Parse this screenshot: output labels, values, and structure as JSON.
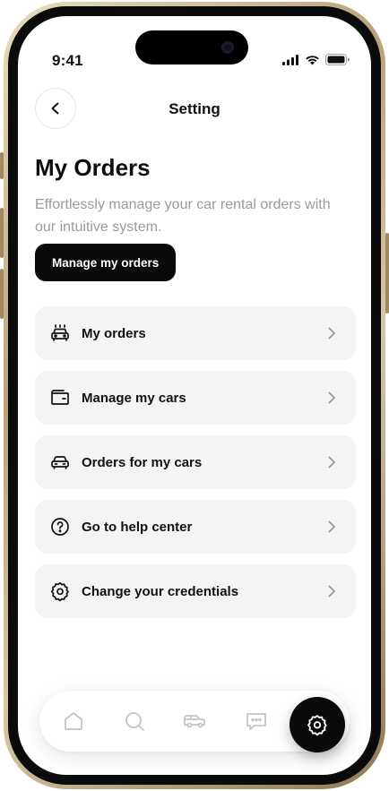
{
  "status_bar": {
    "time": "9:41"
  },
  "header": {
    "title": "Setting"
  },
  "intro": {
    "title": "My Orders",
    "subtitle": "Effortlessly manage your car rental orders with our intuitive system.",
    "cta_label": "Manage my orders"
  },
  "menu": {
    "items": [
      {
        "label": "My orders",
        "icon": "car-front-icon"
      },
      {
        "label": "Manage my cars",
        "icon": "wallet-icon"
      },
      {
        "label": "Orders for my cars",
        "icon": "car-icon"
      },
      {
        "label": "Go to help center",
        "icon": "help-circle-icon"
      },
      {
        "label": "Change your credentials",
        "icon": "gear-icon"
      }
    ]
  },
  "bottom_nav": {
    "items": [
      "home-icon",
      "search-icon",
      "van-icon",
      "chat-icon",
      "settings-icon"
    ],
    "active": "settings-icon"
  },
  "colors": {
    "accent": "#0a0a0a",
    "card": "#f4f4f4",
    "muted_text": "#9a9a9a",
    "inactive_icon": "#c4c4c4"
  }
}
